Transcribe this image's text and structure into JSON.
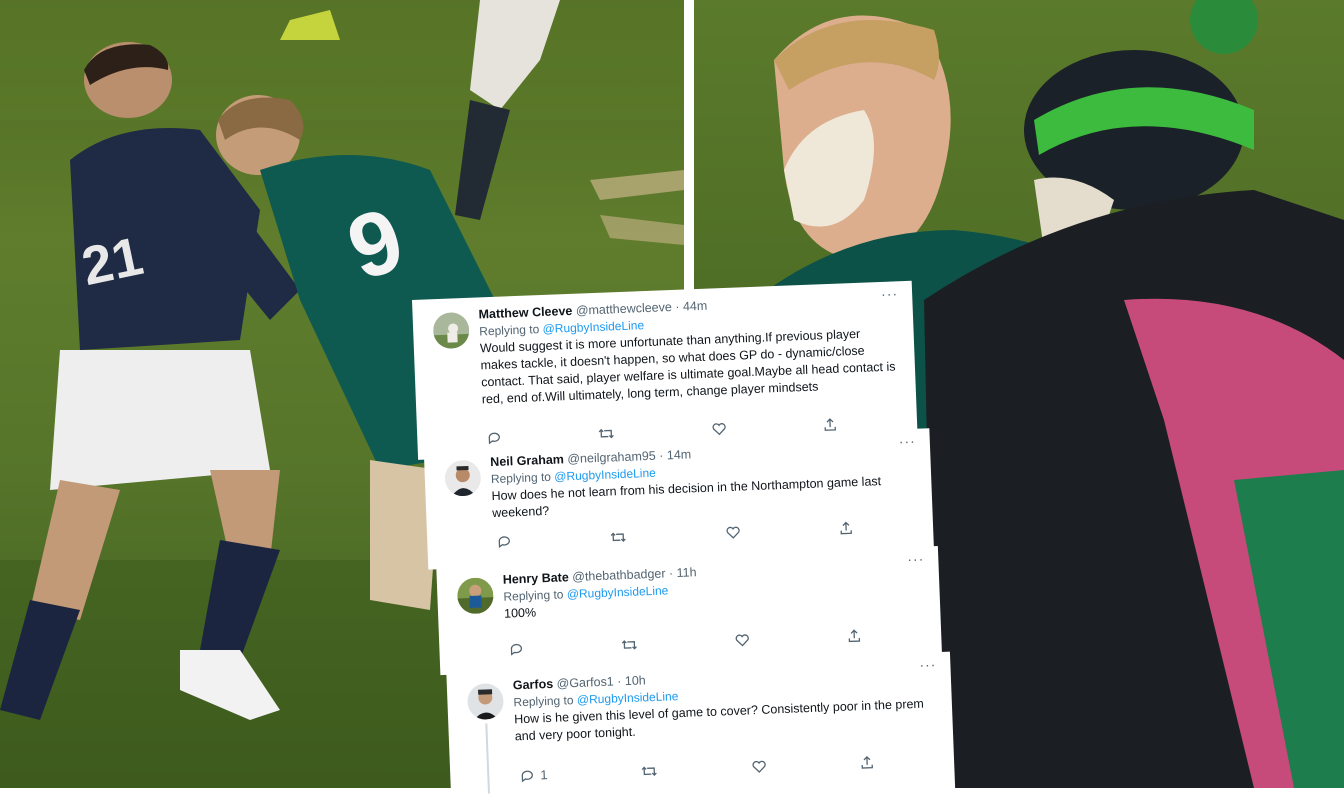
{
  "tweets": [
    {
      "name": "Matthew Cleeve",
      "handle": "@matthewcleeve",
      "time": "44m",
      "replying_label": "Replying to",
      "replying_to": "@RugbyInsideLine",
      "text": "Would suggest it is more unfortunate than anything.If previous player makes tackle, it doesn't happen, so what does GP do - dynamic/close contact. That said, player welfare is ultimate goal.Maybe all head contact is red, end of.Will ultimately, long term, change player mindsets",
      "avatar": "avatar-photo-icon"
    },
    {
      "name": "Neil Graham",
      "handle": "@neilgraham95",
      "time": "14m",
      "replying_label": "Replying to",
      "replying_to": "@RugbyInsideLine",
      "text": "How does he not learn from his decision in the Northampton game last weekend?",
      "avatar": "avatar-photo-icon"
    },
    {
      "name": "Henry Bate",
      "handle": "@thebathbadger",
      "time": "11h",
      "replying_label": "Replying to",
      "replying_to": "@RugbyInsideLine",
      "text": "100%",
      "avatar": "avatar-photo-icon"
    },
    {
      "name": "Garfos",
      "handle": "@Garfos1",
      "time": "10h",
      "replying_label": "Replying to",
      "replying_to": "@RugbyInsideLine",
      "text": "How is he given this level of game to cover? Consistently poor in the prem and very poor tonight.",
      "avatar": "avatar-photo-icon",
      "reply_count": "1"
    }
  ],
  "dot": "·",
  "more": "···",
  "jersey_numbers": {
    "left_player": "21",
    "green_player": "9"
  },
  "colors": {
    "accent": "#1d9bf0",
    "muted": "#536471",
    "text": "#0f1419"
  }
}
